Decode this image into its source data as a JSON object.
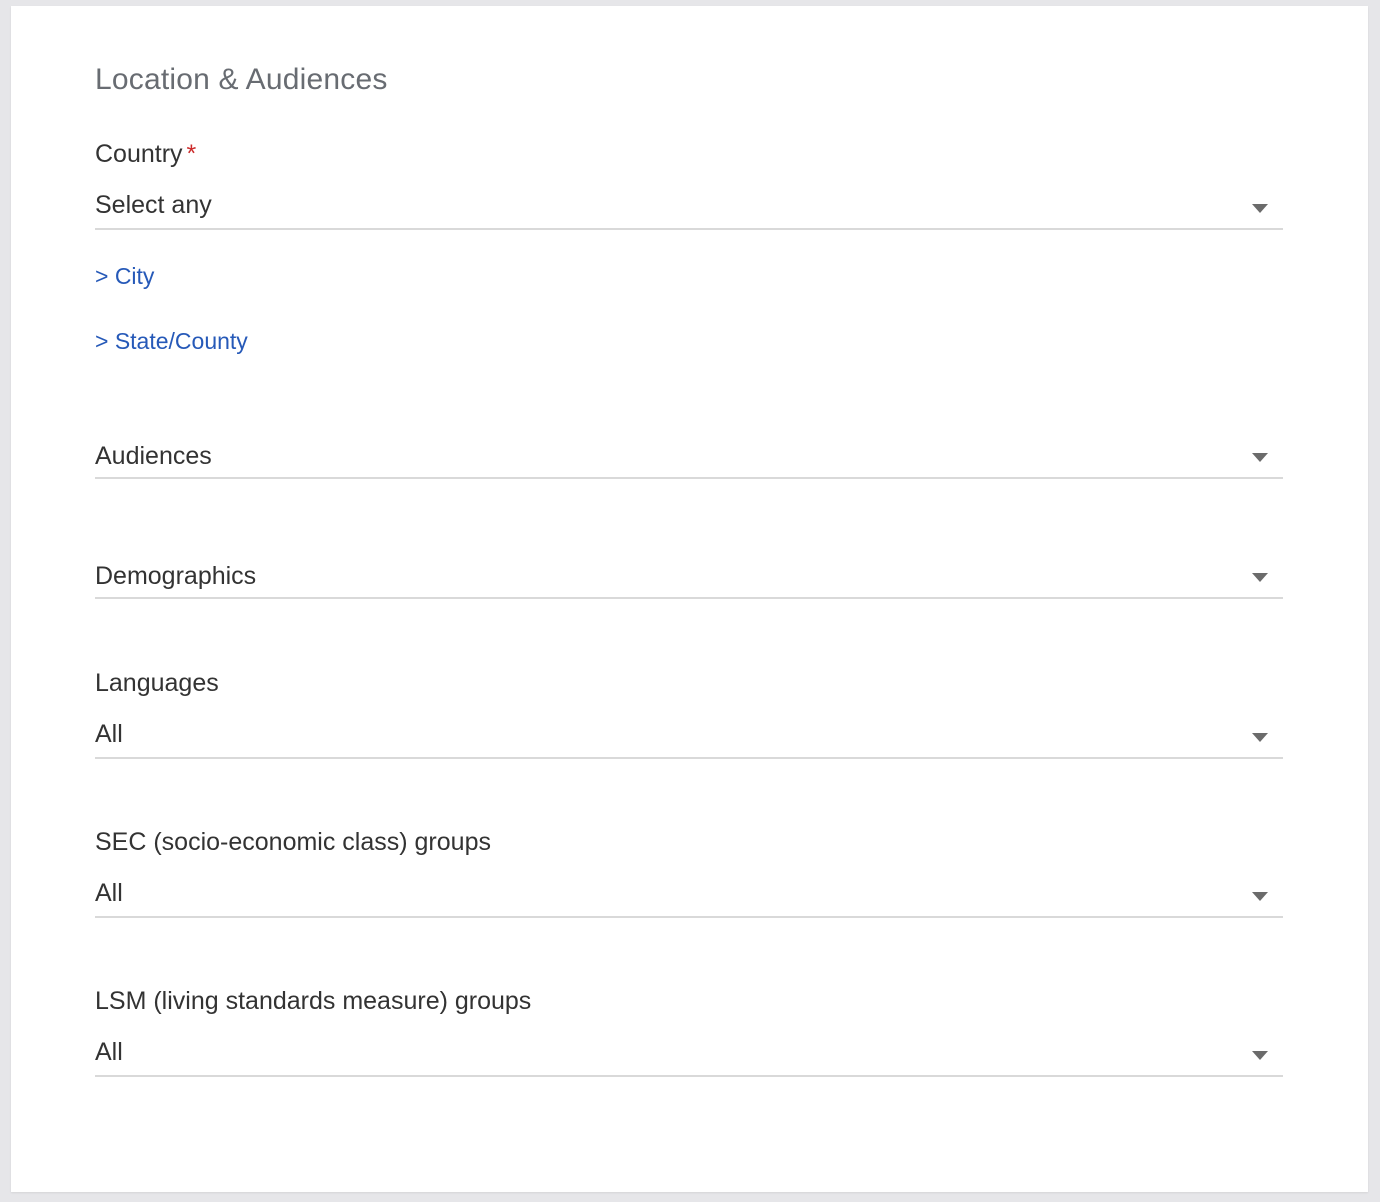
{
  "section": {
    "title": "Location & Audiences"
  },
  "country": {
    "label": "Country",
    "required_mark": "*",
    "value": "Select any"
  },
  "links": {
    "city": "> City",
    "state": "> State/County"
  },
  "audiences": {
    "label": "Audiences"
  },
  "demographics": {
    "label": "Demographics"
  },
  "languages": {
    "label": "Languages",
    "value": "All"
  },
  "sec": {
    "label": "SEC (socio-economic class) groups",
    "value": "All"
  },
  "lsm": {
    "label": "LSM (living standards measure) groups",
    "value": "All"
  },
  "colors": {
    "link": "#2659b8",
    "required": "#cc2b2b",
    "title": "#686c72",
    "text": "#333333",
    "divider": "#d9d9d9",
    "page_bg": "#e6e6e9"
  }
}
